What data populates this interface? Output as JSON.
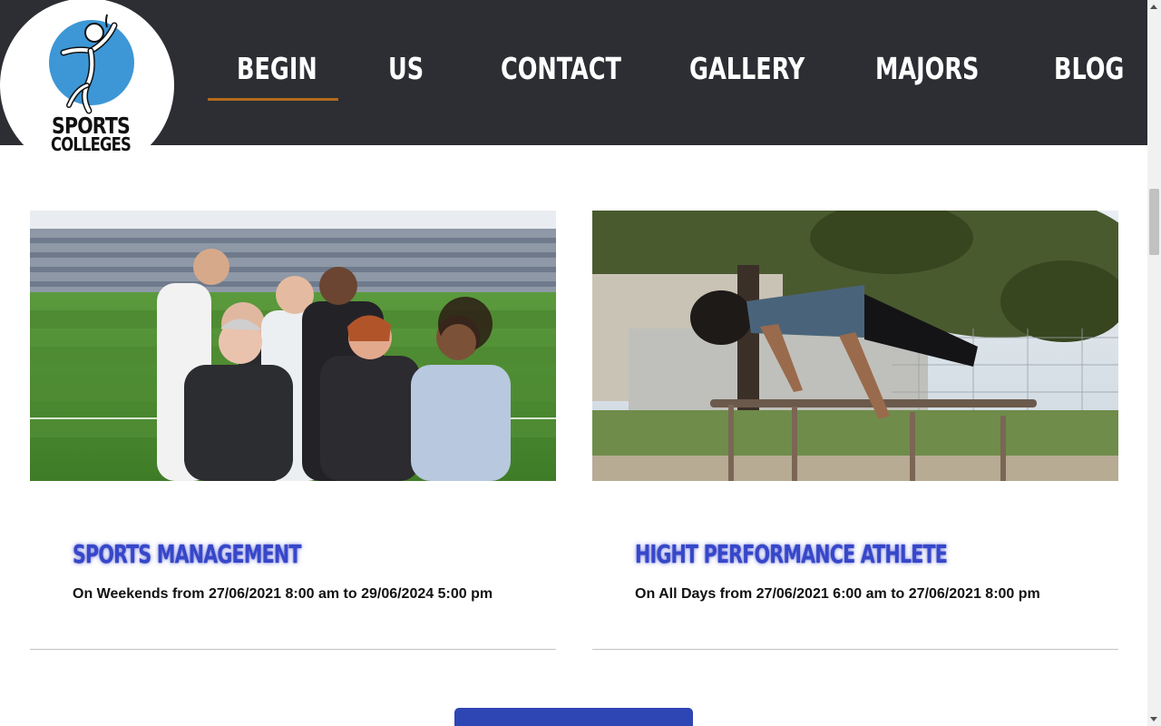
{
  "brand": {
    "line1": "SPORTS",
    "line2": "COLLEGES",
    "logo_icon": "athlete-figure-icon",
    "colors": {
      "header_bg": "#2c2e33",
      "logo_blue": "#3d97d6",
      "nav_active_underline": "#b26a1c"
    }
  },
  "nav": {
    "items": [
      {
        "label": "BEGIN",
        "active": true
      },
      {
        "label": "US",
        "active": false
      },
      {
        "label": "CONTACT",
        "active": false
      },
      {
        "label": "GALLERY",
        "active": false
      },
      {
        "label": "MAJORS",
        "active": false
      },
      {
        "label": "BLOG",
        "active": false
      }
    ]
  },
  "programs": [
    {
      "title": "SPORTS MANAGEMENT",
      "schedule": "On Weekends from 27/06/2021 8:00 am to 29/06/2024 5:00 pm",
      "image": "business-team-in-stadium-photo"
    },
    {
      "title": "HIGHT PERFORMANCE ATHLETE",
      "schedule": "On All Days from 27/06/2021 6:00 am to 27/06/2021 8:00 pm",
      "image": "athlete-on-parallel-bars-photo"
    }
  ],
  "styles": {
    "title_color": "#3647c9",
    "button_color": "#2e45b4"
  }
}
